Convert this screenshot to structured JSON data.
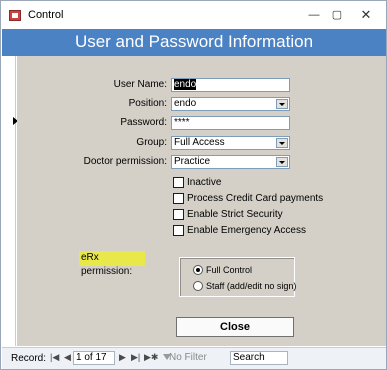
{
  "window": {
    "title": "Control",
    "minimize_glyph": "—",
    "maximize_glyph": "▢",
    "close_glyph": "✕"
  },
  "form": {
    "header_title": "User and Password Information",
    "fields": {
      "user_name": {
        "label": "User Name:",
        "value": "endo"
      },
      "position": {
        "label": "Position:",
        "value": "endo"
      },
      "password": {
        "label": "Password:",
        "value": "****"
      },
      "group": {
        "label": "Group:",
        "value": "Full Access"
      },
      "doctor_permission": {
        "label": "Doctor permission:",
        "value": "Practice"
      }
    },
    "checkboxes": [
      {
        "label": "Inactive",
        "checked": false
      },
      {
        "label": "Process Credit Card payments",
        "checked": false
      },
      {
        "label": "Enable Strict Security",
        "checked": false
      },
      {
        "label": "Enable Emergency Access",
        "checked": false
      }
    ],
    "erx": {
      "label": "eRx permission:",
      "highlight_color": "#e8e84a",
      "options": [
        {
          "label": "Full Control",
          "selected": true
        },
        {
          "label": "Staff (add/edit no sign)",
          "selected": false
        }
      ]
    },
    "close_label": "Close"
  },
  "nav": {
    "record_label": "Record:",
    "first_glyph": "|◀",
    "prev_glyph": "◀",
    "position": "1 of 17",
    "next_glyph": "▶",
    "last_glyph": "▶|",
    "new_glyph": "▶✱",
    "filter_label": "No Filter",
    "search_label": "Search"
  },
  "colors": {
    "header": "#4a82c4",
    "detail_background": "#d4d0c8"
  }
}
